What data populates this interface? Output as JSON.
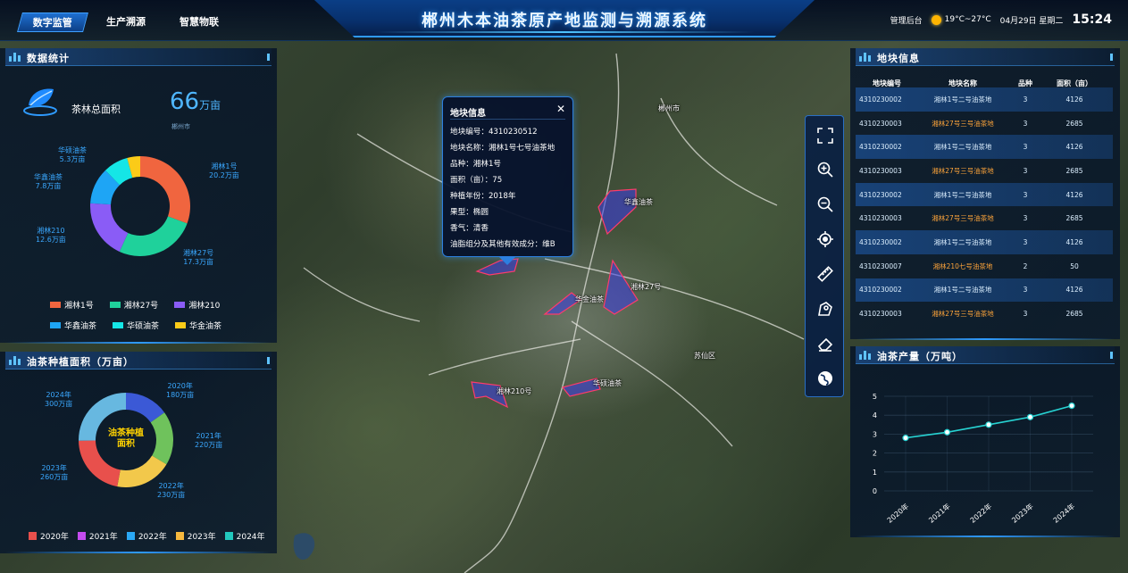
{
  "header": {
    "title": "郴州木本油茶原产地监测与溯源系统",
    "nav": [
      "数字监管",
      "生产溯源",
      "智慧物联"
    ],
    "admin": "管理后台",
    "weather": "19°C~27°C",
    "date": "04月29日 星期二",
    "time": "15:24"
  },
  "stats": {
    "title": "数据统计",
    "total_label": "茶林总面积",
    "total_value": "66",
    "total_unit": "万亩",
    "region": "郴州市",
    "donut_labels": {
      "hy53": [
        "华硕油茶",
        "5.3万亩"
      ],
      "hx78": [
        "华鑫油茶",
        "7.8万亩"
      ],
      "x210": [
        "湘林210",
        "12.6万亩"
      ],
      "x27": [
        "湘林27号",
        "17.3万亩"
      ],
      "x1": [
        "湘林1号",
        "20.2万亩"
      ]
    },
    "legend": [
      "湘林1号",
      "湘林27号",
      "湘林210",
      "华鑫油茶",
      "华硕油茶",
      "华金油茶"
    ]
  },
  "planting": {
    "title": "油茶种植面积（万亩）",
    "center": "油茶种植面积",
    "labels": {
      "y2020": [
        "2020年",
        "180万亩"
      ],
      "y2021": [
        "2021年",
        "220万亩"
      ],
      "y2022": [
        "2022年",
        "230万亩"
      ],
      "y2023": [
        "2023年",
        "260万亩"
      ],
      "y2024": [
        "2024年",
        "300万亩"
      ]
    },
    "legend": [
      "2020年",
      "2021年",
      "2022年",
      "2023年",
      "2024年"
    ]
  },
  "plots": {
    "title": "地块信息",
    "columns": [
      "地块编号",
      "地块名称",
      "品种",
      "面积（亩）"
    ],
    "rows": [
      [
        "4310230002",
        "湘林1号二号油茶地",
        "3",
        "4126"
      ],
      [
        "4310230003",
        "湘林27号三号油茶地",
        "3",
        "2685"
      ],
      [
        "4310230002",
        "湘林1号二号油茶地",
        "3",
        "4126"
      ],
      [
        "4310230003",
        "湘林27号三号油茶地",
        "3",
        "2685"
      ],
      [
        "4310230002",
        "湘林1号二号油茶地",
        "3",
        "4126"
      ],
      [
        "4310230003",
        "湘林27号三号油茶地",
        "3",
        "2685"
      ],
      [
        "4310230002",
        "湘林1号二号油茶地",
        "3",
        "4126"
      ],
      [
        "4310230007",
        "湘林210七号油茶地",
        "2",
        "50"
      ],
      [
        "4310230002",
        "湘林1号二号油茶地",
        "3",
        "4126"
      ],
      [
        "4310230003",
        "湘林27号三号油茶地",
        "3",
        "2685"
      ]
    ]
  },
  "popup": {
    "title": "地块信息",
    "rows": [
      "地块编号：4310230512",
      "地块名称：湘林1号七号油茶地",
      "品种：湘林1号",
      "面积（亩）：75",
      "种植年份：2018年",
      "果型：椭圆",
      "香气：清香",
      "油脂组分及其他有效成分：维B"
    ]
  },
  "map": {
    "labels": {
      "chenzhou": "郴州市",
      "huaxin": "华鑫油茶",
      "x27": "湘林27号",
      "huajin": "华金油茶",
      "x210": "湘林210号",
      "huashuo": "华硕油茶",
      "suxian": "苏仙区"
    }
  },
  "toolbar": [
    "fullscreen-icon",
    "zoom-in-icon",
    "zoom-out-icon",
    "locate-icon",
    "measure-icon",
    "draw-area-icon",
    "eraser-icon",
    "globe-icon"
  ],
  "production": {
    "title": "油茶产量（万吨）",
    "chart_data": {
      "type": "line",
      "title": "油茶产量（万吨）",
      "categories": [
        "2020年",
        "2021年",
        "2022年",
        "2023年",
        "2024年"
      ],
      "values": [
        2.8,
        3.1,
        3.5,
        3.9,
        4.5
      ],
      "ylim": [
        0,
        5
      ],
      "yticks": [
        0,
        1,
        2,
        3,
        4,
        5
      ],
      "color": "#27d3d3"
    }
  },
  "colors": {
    "x1": "#f0653f",
    "x27": "#1fd19b",
    "x210": "#8a5cf6",
    "huaxin": "#1ea5f5",
    "huashuo": "#15e6e6",
    "huajin": "#fbcb18",
    "y2020": "#e8504c",
    "y2021": "#c44cf0",
    "y2022": "#2aa8f5",
    "y2023": "#f7b93e",
    "y2024": "#22c8bd"
  }
}
